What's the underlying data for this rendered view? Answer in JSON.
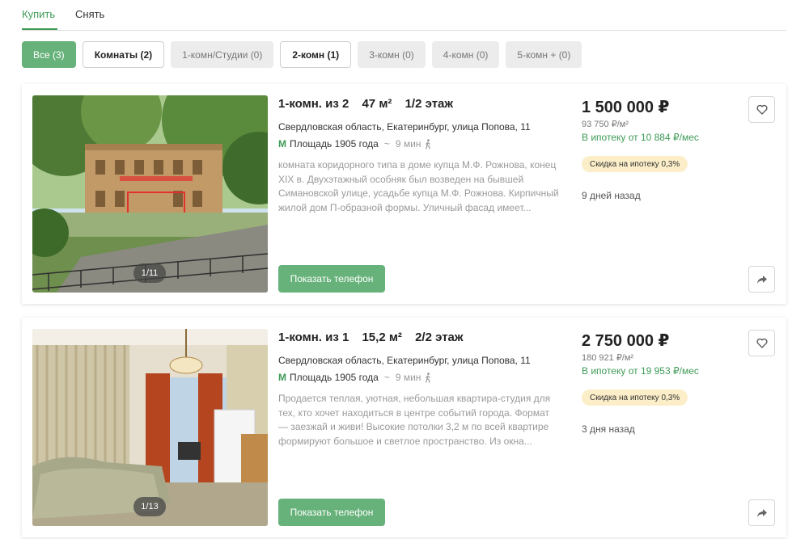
{
  "tabs": [
    {
      "label": "Купить",
      "active": true
    },
    {
      "label": "Снять",
      "active": false
    }
  ],
  "filters": [
    {
      "label": "Все (3)",
      "state": "selected"
    },
    {
      "label": "Комнаты (2)",
      "state": "outlined"
    },
    {
      "label": "1-комн/Студии (0)",
      "state": "disabled"
    },
    {
      "label": "2-комн (1)",
      "state": "outlined"
    },
    {
      "label": "3-комн (0)",
      "state": "disabled"
    },
    {
      "label": "4-комн (0)",
      "state": "disabled"
    },
    {
      "label": "5-комн + (0)",
      "state": "disabled"
    }
  ],
  "colors": {
    "accent": "#67b27a",
    "accent_text": "#3e9b57",
    "discount_bg": "#fbeec8"
  },
  "listings": [
    {
      "rooms": "1-комн. из 2",
      "area": "47 м²",
      "floor": "1/2 этаж",
      "address": "Свердловская область, Екатеринбург, улица Попова, 11",
      "metro_icon": "М",
      "metro": "Площадь 1905 года",
      "walk": "9 мин",
      "description": "комната коридорного типа в доме купца М.Ф. Рожнова, конец XIX в. Двухэтажный особняк был возведен на бывшей Симановской улице, усадьбе купца М.Ф. Рожнова. Кирпичный жилой дом П-образной формы. Уличный фасад имеет...",
      "photo_counter": "1/11",
      "phone_button": "Показать телефон",
      "price": "1 500 000 ₽",
      "price_per_m": "93 750 ₽/м²",
      "mortgage": "В ипотеку от 10 884 ₽/мес",
      "discount": "Скидка на ипотеку 0,3%",
      "posted": "9 дней назад"
    },
    {
      "rooms": "1-комн. из 1",
      "area": "15,2 м²",
      "floor": "2/2 этаж",
      "address": "Свердловская область, Екатеринбург, улица Попова, 11",
      "metro_icon": "М",
      "metro": "Площадь 1905 года",
      "walk": "9 мин",
      "description": "Продается теплая, уютная, небольшая квартира-студия для тех, кто хочет находиться в центре событий города. Формат — заезжай и живи! Высокие потолки 3,2 м по всей квартире формируют большое и светлое пространство. Из окна...",
      "photo_counter": "1/13",
      "phone_button": "Показать телефон",
      "price": "2 750 000 ₽",
      "price_per_m": "180 921 ₽/м²",
      "mortgage": "В ипотеку от 19 953 ₽/мес",
      "discount": "Скидка на ипотеку 0,3%",
      "posted": "3 дня назад"
    }
  ]
}
